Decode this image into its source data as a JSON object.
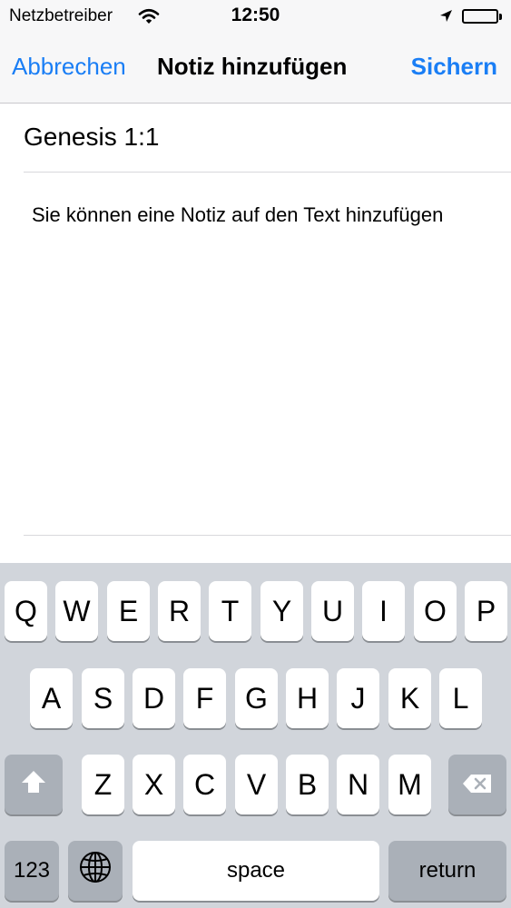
{
  "status_bar": {
    "carrier": "Netzbetreiber",
    "time": "12:50",
    "icons": [
      "wifi-icon",
      "location-arrow-icon",
      "battery-icon"
    ]
  },
  "nav_bar": {
    "cancel_label": "Abbrechen",
    "title": "Notiz hinzufügen",
    "save_label": "Sichern"
  },
  "content": {
    "reference": "Genesis 1:1",
    "note_placeholder": "Sie können eine Notiz auf den Text hinzufügen",
    "note_value": ""
  },
  "keyboard": {
    "row1": [
      "Q",
      "W",
      "E",
      "R",
      "T",
      "Y",
      "U",
      "I",
      "O",
      "P"
    ],
    "row2": [
      "A",
      "S",
      "D",
      "F",
      "G",
      "H",
      "J",
      "K",
      "L"
    ],
    "row3": [
      "Z",
      "X",
      "C",
      "V",
      "B",
      "N",
      "M"
    ],
    "numbers_label": "123",
    "space_label": "space",
    "return_label": "return",
    "icons": [
      "shift-icon",
      "backspace-icon",
      "globe-icon"
    ]
  },
  "colors": {
    "accent": "#1a7ef5",
    "keyboard_background": "#d1d5db",
    "key_dark": "#aab0b8"
  }
}
